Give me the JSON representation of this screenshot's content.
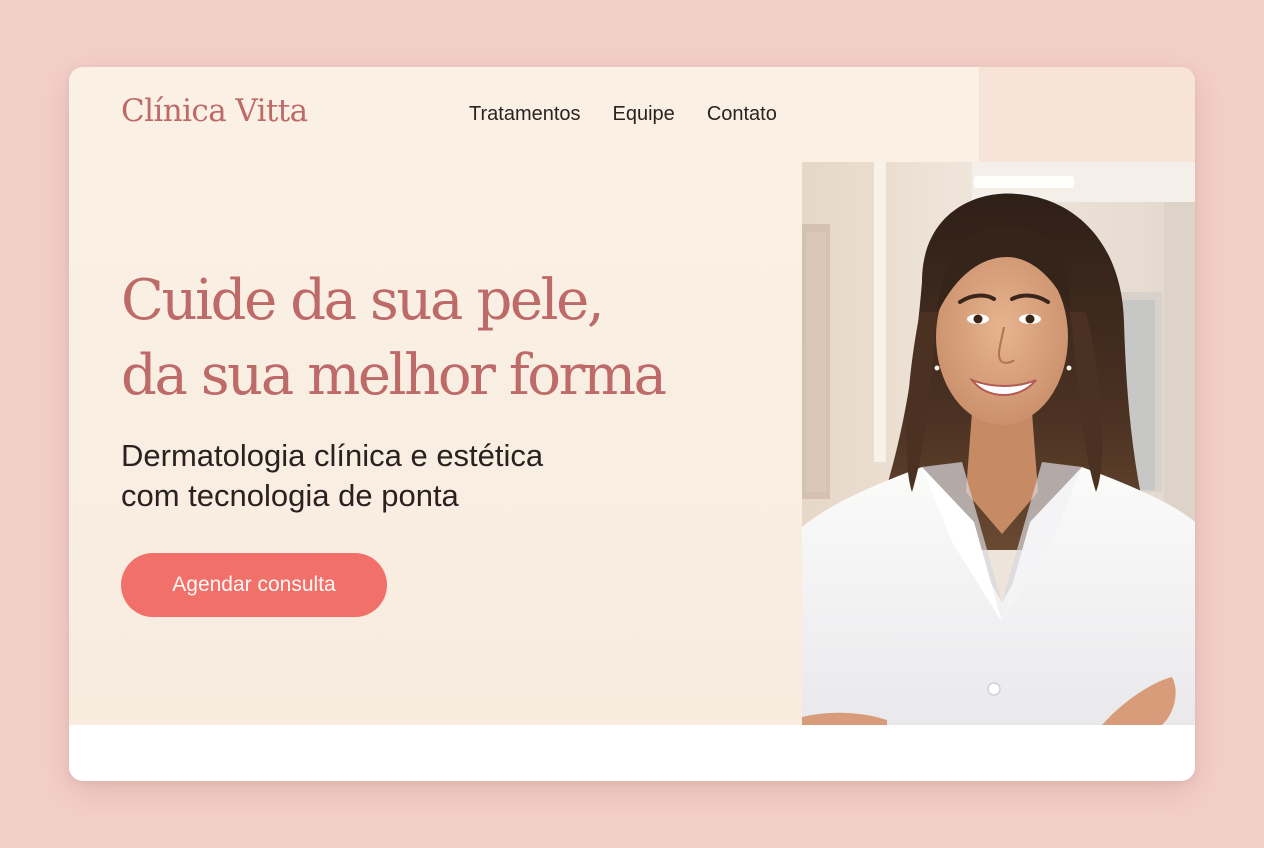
{
  "brand": {
    "logo": "Clínica Vitta",
    "primary_color": "#bd6a68",
    "accent_color": "#f2706a",
    "background_color": "#f2cfc8",
    "hero_color": "#faf1e4"
  },
  "nav": {
    "items": [
      {
        "label": "Tratamentos"
      },
      {
        "label": "Equipe"
      },
      {
        "label": "Contato"
      }
    ]
  },
  "hero": {
    "headline_line1": "Cuide da sua pele,",
    "headline_line2": "da sua melhor forma",
    "subhead_line1": "Dermatologia clínica e estética",
    "subhead_line2": "com tecnologia de ponta",
    "cta_label": "Agendar consulta"
  },
  "photo": {
    "alt": "Dermatologista sorridente de jaleco branco em consultório"
  }
}
